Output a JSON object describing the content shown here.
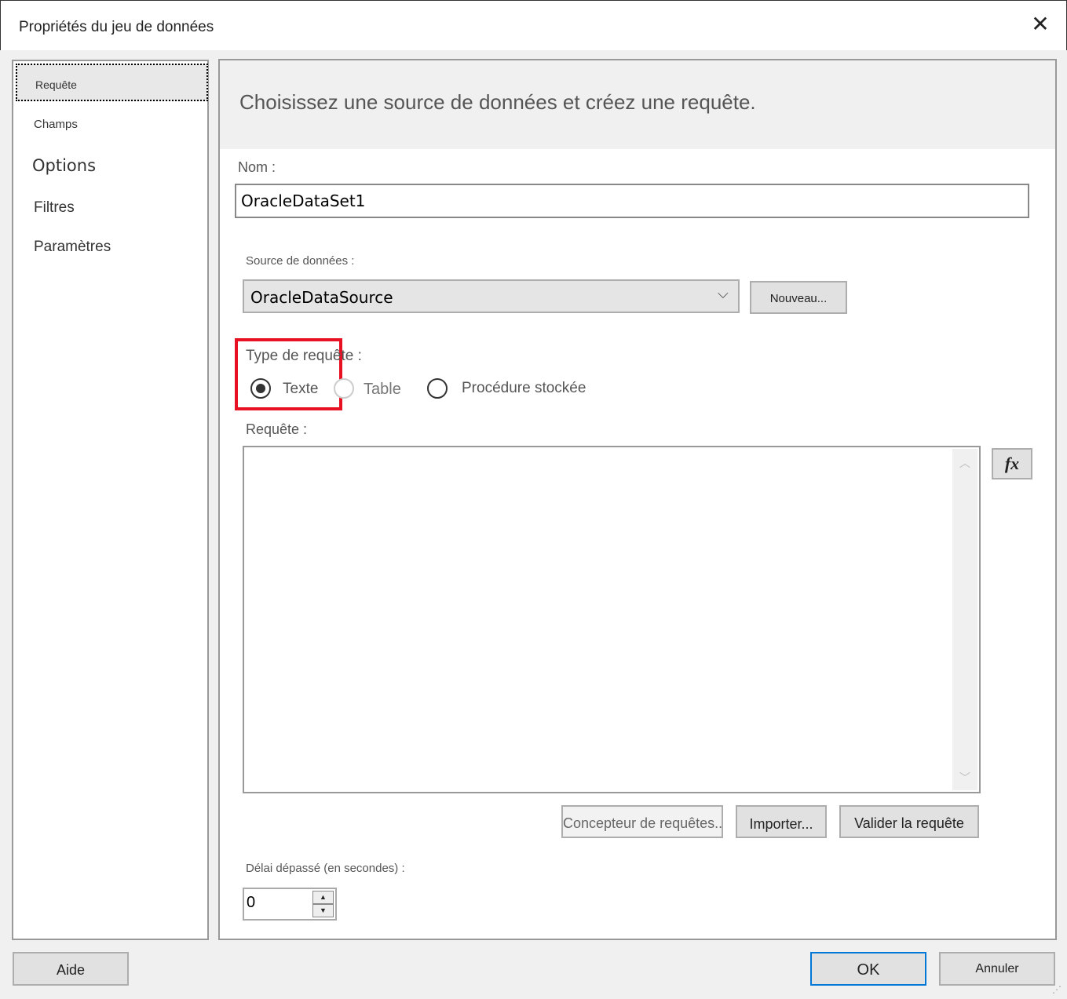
{
  "window": {
    "title": "Propriétés du jeu de données",
    "close_icon": "close-icon"
  },
  "sidebar": {
    "items": [
      {
        "label": "Requête",
        "selected": true
      },
      {
        "label": "Champs"
      },
      {
        "label": "Options"
      },
      {
        "label": "Filtres"
      },
      {
        "label": "Paramètres"
      }
    ]
  },
  "main": {
    "header": "Choisissez une source de données et créez une requête.",
    "name_label": "Nom :",
    "name_value": "OracleDataSet1",
    "datasource_label": "Source de données :",
    "datasource_value": "OracleDataSource",
    "new_button": "Nouveau...",
    "query_type_label": "Type de requête :",
    "query_types": [
      {
        "label": "Texte",
        "selected": true
      },
      {
        "label": "Table",
        "selected": false,
        "disabled": true
      },
      {
        "label": "Procédure stockée",
        "selected": false
      }
    ],
    "query_label": "Requête :",
    "query_value": "",
    "fx_button": "fx",
    "designer_button": "Concepteur de requêtes...",
    "import_button": "Importer...",
    "validate_button": "Valider la requête",
    "timeout_label": "Délai dépassé (en secondes) :",
    "timeout_value": "0",
    "highlight_color": "#e81123"
  },
  "footer": {
    "help": "Aide",
    "ok": "OK",
    "cancel": "Annuler"
  }
}
